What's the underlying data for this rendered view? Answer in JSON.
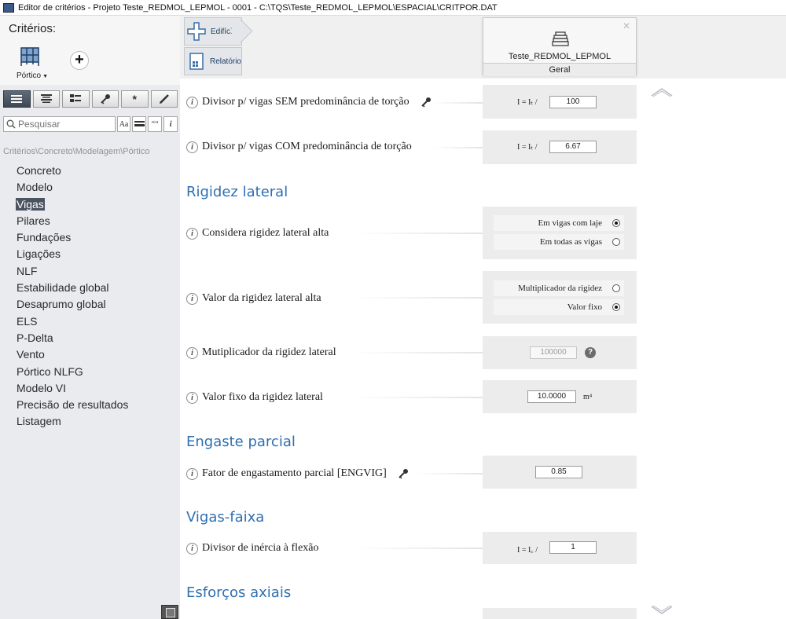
{
  "window": {
    "title": "Editor de critérios - Projeto Teste_REDMOL_LEPMOL - 0001 - C:\\TQS\\Teste_REDMOL_LEPMOL\\ESPACIAL\\CRITPOR.DAT"
  },
  "sidebar": {
    "heading": "Critérios:",
    "portico_label": "Pórtico",
    "search_placeholder": "Pesquisar",
    "search_buttons": [
      "Aa",
      "““",
      "i"
    ],
    "breadcrumb": "Critérios\\Concreto\\Modelagem\\Pórtico",
    "items": [
      "Concreto",
      "Modelo",
      "Vigas",
      "Pilares",
      "Fundações",
      "Ligações",
      "NLF",
      "Estabilidade global",
      "Desaprumo global",
      "ELS",
      "P-Delta",
      "Vento",
      "Pórtico NLFG",
      "Modelo VI",
      "Precisão de resultados",
      "Listagem"
    ],
    "selected": "Vigas"
  },
  "tabs": {
    "edificio": "Edifício",
    "relatorio": "Relatório"
  },
  "model": {
    "name": "Teste_REDMOL_LEPMOL",
    "sub": "Geral"
  },
  "content": {
    "rows": {
      "sem": {
        "label": "Divisor p/ vigas SEM predominância de torção",
        "prefix": "I = Iₜ /",
        "value": "100"
      },
      "com": {
        "label": "Divisor p/ vigas COM predominância de torção",
        "prefix": "I = Iₜ /",
        "value": "6.67"
      },
      "considera": {
        "label": "Considera rigidez lateral alta",
        "opt1": "Em vigas com laje",
        "opt2": "Em todas as vigas"
      },
      "valor": {
        "label": "Valor da rigidez lateral alta",
        "opt1": "Multiplicador da rigidez",
        "opt2": "Valor fixo"
      },
      "mult": {
        "label": "Mutiplicador da rigidez lateral",
        "value": "100000",
        "help": "?"
      },
      "fixo": {
        "label": "Valor fixo da rigidez lateral",
        "value": "10.0000",
        "unit": "m⁴"
      },
      "fator": {
        "label": "Fator de engastamento parcial [ENGVIG]",
        "value": "0.85"
      },
      "divisor": {
        "label": "Divisor de inércia à flexão",
        "prefix": "I = I꜀ /",
        "value": "1"
      }
    },
    "sections": {
      "rigidez": "Rigidez lateral",
      "engaste": "Engaste parcial",
      "vigas_faixa": "Vigas-faixa",
      "esforcos": "Esforços axiais"
    },
    "radio_state": {
      "considera": "Em vigas com laje",
      "valor": "Valor fixo"
    }
  }
}
